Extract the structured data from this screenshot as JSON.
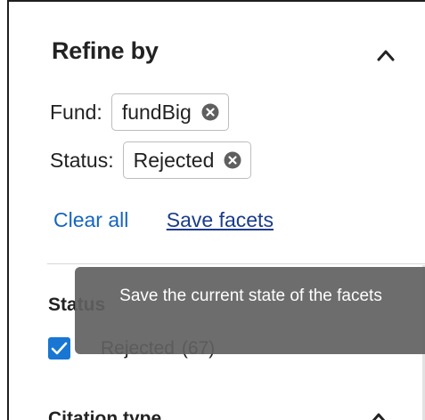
{
  "refine": {
    "title": "Refine by",
    "collapse_icon": "chevron-up-icon"
  },
  "applied_facets": [
    {
      "label": "Fund:",
      "value": "fundBig",
      "remove_icon": "remove-circle-icon"
    },
    {
      "label": "Status:",
      "value": "Rejected",
      "remove_icon": "remove-circle-icon"
    }
  ],
  "actions": {
    "clear_all": "Clear all",
    "save_facets": "Save facets"
  },
  "tooltip": {
    "text": "Save the current state of the facets"
  },
  "status_section": {
    "title": "Status",
    "option_label": "Rejected",
    "option_count": "(67)",
    "checked": true
  },
  "citation_section": {
    "title": "Citation type",
    "toggle_icon": "chevron-up-icon"
  },
  "colors": {
    "link": "#1565c0",
    "checkbox": "#1976d2",
    "tooltip_bg": "#616161"
  }
}
